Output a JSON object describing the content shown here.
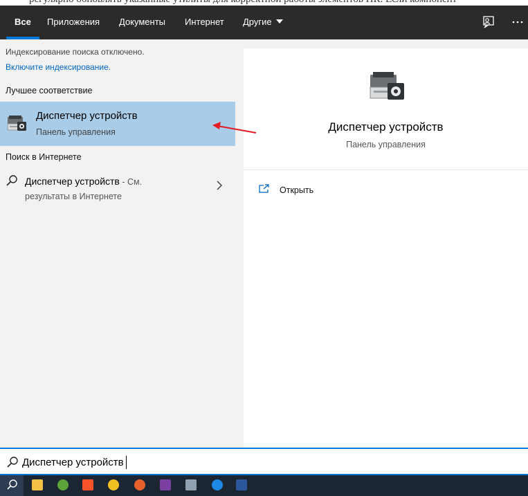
{
  "background_text": "регулярно обновлять указанные утилиты для корректной работы элементов ПК. Если компонент",
  "nav": {
    "tabs": [
      "Все",
      "Приложения",
      "Документы",
      "Интернет"
    ],
    "more_label": "Другие",
    "icons": [
      "feedback-icon",
      "more-icon"
    ]
  },
  "left": {
    "info_text": "Индексирование поиска отключено.",
    "info_link": "Включите индексирование.",
    "best_match_title": "Лучшее соответствие",
    "best_match": {
      "name": "Диспетчер устройств",
      "subtitle": "Панель управления",
      "icon": "device-manager-icon"
    },
    "web_title": "Поиск в Интернете",
    "web_result": {
      "name": "Диспетчер устройств",
      "suffix": " - См.",
      "line2": "результаты в Интернете",
      "icon": "search-icon"
    }
  },
  "right": {
    "title": "Диспетчер устройств",
    "subtitle": "Панель управления",
    "actions": [
      {
        "label": "Открыть",
        "icon": "open-icon"
      }
    ]
  },
  "search": {
    "value": "Диспетчер устройств"
  },
  "taskbar": {
    "apps": [
      "file-explorer-icon",
      "utorrent-icon",
      "brave-icon",
      "arduino-icon",
      "firefox-icon",
      "archive-icon",
      "photos-icon",
      "teamviewer-icon",
      "word-icon"
    ]
  },
  "colors": {
    "accent": "#0078d7",
    "selected_bg": "#a9cce8",
    "navbar_bg": "#2b2b2b",
    "annotation": "#e31b23"
  }
}
